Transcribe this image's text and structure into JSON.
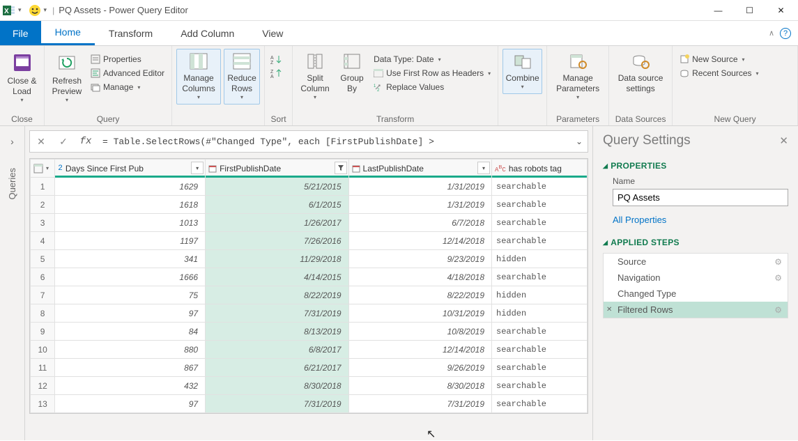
{
  "window": {
    "title": "PQ Assets - Power Query Editor"
  },
  "menubar": {
    "file": "File",
    "tabs": [
      "Home",
      "Transform",
      "Add Column",
      "View"
    ],
    "active_tab": "Home"
  },
  "ribbon": {
    "close_load": "Close &\nLoad",
    "close_group": "Close",
    "refresh_preview": "Refresh\nPreview",
    "properties": "Properties",
    "advanced_editor": "Advanced Editor",
    "manage": "Manage",
    "query_group": "Query",
    "manage_columns": "Manage\nColumns",
    "reduce_rows": "Reduce\nRows",
    "sort_group": "Sort",
    "split_column": "Split\nColumn",
    "group_by": "Group\nBy",
    "data_type": "Data Type: Date",
    "first_row_headers": "Use First Row as Headers",
    "replace_values": "Replace Values",
    "transform_group": "Transform",
    "combine": "Combine",
    "manage_parameters": "Manage\nParameters",
    "parameters_group": "Parameters",
    "data_source_settings": "Data source\nsettings",
    "data_sources_group": "Data Sources",
    "new_source": "New Source",
    "recent_sources": "Recent Sources",
    "new_query_group": "New Query"
  },
  "queries_rail": {
    "label": "Queries"
  },
  "formula": {
    "fx": "fx",
    "text": "= Table.SelectRows(#\"Changed Type\", each [FirstPublishDate] >"
  },
  "columns": {
    "days": "Days Since First Pub",
    "first": "FirstPublishDate",
    "last": "LastPublishDate",
    "robots": "has robots tag",
    "type_num": "1.2",
    "type_date": "📅",
    "type_abc": "ABC"
  },
  "rows": [
    {
      "n": "1",
      "days": "1629",
      "first": "5/21/2015",
      "last": "1/31/2019",
      "robots": "searchable"
    },
    {
      "n": "2",
      "days": "1618",
      "first": "6/1/2015",
      "last": "1/31/2019",
      "robots": "searchable"
    },
    {
      "n": "3",
      "days": "1013",
      "first": "1/26/2017",
      "last": "6/7/2018",
      "robots": "searchable"
    },
    {
      "n": "4",
      "days": "1197",
      "first": "7/26/2016",
      "last": "12/14/2018",
      "robots": "searchable"
    },
    {
      "n": "5",
      "days": "341",
      "first": "11/29/2018",
      "last": "9/23/2019",
      "robots": "hidden"
    },
    {
      "n": "6",
      "days": "1666",
      "first": "4/14/2015",
      "last": "4/18/2018",
      "robots": "searchable"
    },
    {
      "n": "7",
      "days": "75",
      "first": "8/22/2019",
      "last": "8/22/2019",
      "robots": "hidden"
    },
    {
      "n": "8",
      "days": "97",
      "first": "7/31/2019",
      "last": "10/31/2019",
      "robots": "hidden"
    },
    {
      "n": "9",
      "days": "84",
      "first": "8/13/2019",
      "last": "10/8/2019",
      "robots": "searchable"
    },
    {
      "n": "10",
      "days": "880",
      "first": "6/8/2017",
      "last": "12/14/2018",
      "robots": "searchable"
    },
    {
      "n": "11",
      "days": "867",
      "first": "6/21/2017",
      "last": "9/26/2019",
      "robots": "searchable"
    },
    {
      "n": "12",
      "days": "432",
      "first": "8/30/2018",
      "last": "8/30/2018",
      "robots": "searchable"
    },
    {
      "n": "13",
      "days": "97",
      "first": "7/31/2019",
      "last": "7/31/2019",
      "robots": "searchable"
    }
  ],
  "settings": {
    "title": "Query Settings",
    "properties_hd": "PROPERTIES",
    "name_label": "Name",
    "name_value": "PQ Assets",
    "all_properties": "All Properties",
    "applied_steps_hd": "APPLIED STEPS",
    "steps": [
      "Source",
      "Navigation",
      "Changed Type",
      "Filtered Rows"
    ]
  }
}
